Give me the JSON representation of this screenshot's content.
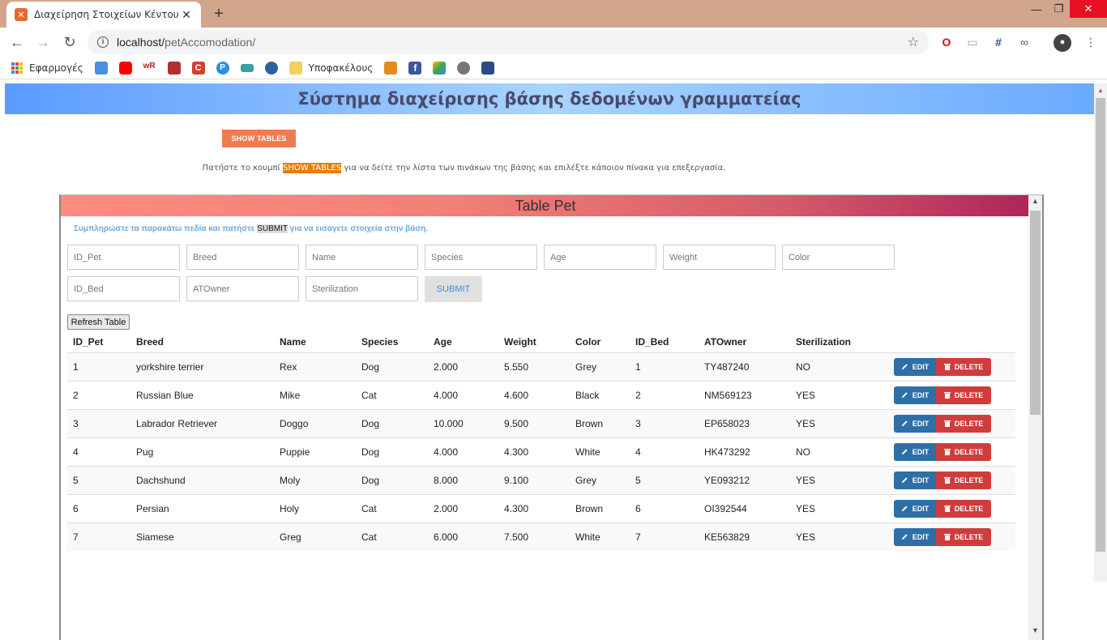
{
  "browser": {
    "tab_title": "Διαχείρηση Στοιχείων Κέντου φι",
    "url_host": "localhost/",
    "url_path": "petAccomodation/",
    "bookmarks": [
      {
        "name": "apps",
        "label": "Εφαρμογές",
        "color": "#4285f4"
      },
      {
        "name": "translate",
        "label": "",
        "color": "#4a90e2"
      },
      {
        "name": "youtube",
        "label": "",
        "color": "#ff0000"
      },
      {
        "name": "wordreference",
        "label": "",
        "color": "#e0a000"
      },
      {
        "name": "university",
        "label": "",
        "color": "#b03030"
      },
      {
        "name": "c-site",
        "label": "",
        "color": "#d04030"
      },
      {
        "name": "p-site",
        "label": "",
        "color": "#2a8fe0"
      },
      {
        "name": "book",
        "label": "",
        "color": "#3aa0a0"
      },
      {
        "name": "ed-site",
        "label": "",
        "color": "#3060a0"
      },
      {
        "name": "folder",
        "label": "Υποφακέλους",
        "color": "#f6cf57"
      },
      {
        "name": "puzzle",
        "label": "",
        "color": "#e58a1f"
      },
      {
        "name": "facebook",
        "label": "",
        "color": "#3b5998"
      },
      {
        "name": "drive",
        "label": "",
        "color": "#34a853"
      },
      {
        "name": "globe",
        "label": "",
        "color": "#777777"
      },
      {
        "name": "tool",
        "label": "",
        "color": "#2b4a8a"
      }
    ]
  },
  "page": {
    "header": "Σύστημα διαχείρισης βάσης δεδομένων γραμματείας",
    "show_tables_label": "SHOW TABLES",
    "instructions_pre": "Πατήστε το κουμπί ",
    "instructions_hl": "SHOW TABLES",
    "instructions_post": " για να δείτε την λίστα των πινάκων της βάσης και επιλέξτε κάποιον πίνακα για επεξεργασία."
  },
  "panel": {
    "title": "Table Pet",
    "note_pre": "Συμπληρώστε τα παρακάτω πεδία και πατήστε ",
    "note_submit": "SUBMIT",
    "note_post": " για να εισάγετε στοιχεία στην βάση.",
    "fields": [
      "ID_Pet",
      "Breed",
      "Name",
      "Species",
      "Age",
      "Weight",
      "Color",
      "ID_Bed",
      "ATOwner",
      "Sterilization"
    ],
    "submit_label": "SUBMIT",
    "refresh_label": "Refresh Table",
    "edit_label": "EDIT",
    "delete_label": "DELETE",
    "columns": [
      "ID_Pet",
      "Breed",
      "Name",
      "Species",
      "Age",
      "Weight",
      "Color",
      "ID_Bed",
      "ATOwner",
      "Sterilization"
    ],
    "rows": [
      [
        "1",
        "yorkshire terrier",
        "Rex",
        "Dog",
        "2.000",
        "5.550",
        "Grey",
        "1",
        "TY487240",
        "NO"
      ],
      [
        "2",
        "Russian Blue",
        "Mike",
        "Cat",
        "4.000",
        "4.600",
        "Black",
        "2",
        "NM569123",
        "YES"
      ],
      [
        "3",
        "Labrador Retriever",
        "Doggo",
        "Dog",
        "10.000",
        "9.500",
        "Brown",
        "3",
        "EP658023",
        "YES"
      ],
      [
        "4",
        "Pug",
        "Puppie",
        "Dog",
        "4.000",
        "4.300",
        "White",
        "4",
        "HK473292",
        "NO"
      ],
      [
        "5",
        "Dachshund",
        "Moly",
        "Dog",
        "8.000",
        "9.100",
        "Grey",
        "5",
        "YE093212",
        "YES"
      ],
      [
        "6",
        "Persian",
        "Holy",
        "Cat",
        "2.000",
        "4.300",
        "Brown",
        "6",
        "OI392544",
        "YES"
      ],
      [
        "7",
        "Siamese",
        "Greg",
        "Cat",
        "6.000",
        "7.500",
        "White",
        "7",
        "KE563829",
        "YES"
      ]
    ]
  }
}
